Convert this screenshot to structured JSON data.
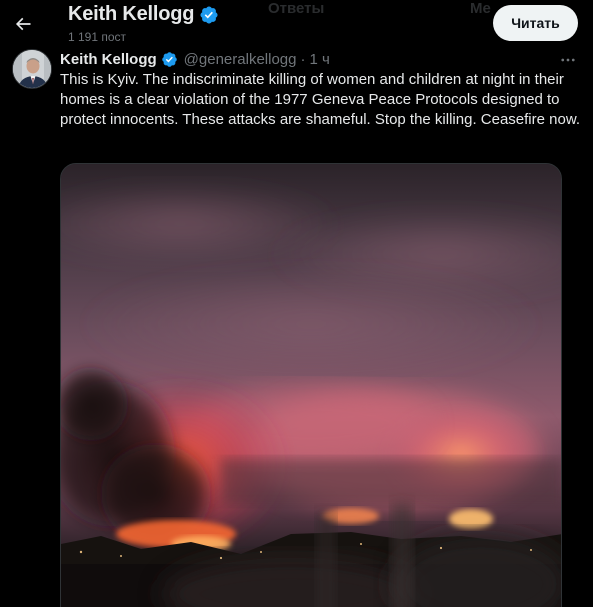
{
  "header": {
    "back_icon": "arrow-left-icon",
    "name": "Keith Kellogg",
    "verified_icon": "verified-badge-icon",
    "post_count": "1 191 пост",
    "follow_label": "Читать",
    "background_tabs": [
      "Ответы",
      "Ме"
    ]
  },
  "tweet": {
    "avatar_icon": "profile-photo",
    "author_name": "Keith Kellogg",
    "verified_icon": "verified-badge-icon",
    "handle": "@generalkellogg",
    "separator": "·",
    "time": "1 ч",
    "more_icon": "more-options-icon",
    "text": "This is Kyiv. The indiscriminate killing of women and children at night in their homes is a clear violation of the 1977 Geneva Peace Protocols designed to protect innocents. These attacks are shameful. Stop the killing. Ceasefire now.",
    "media": {
      "type": "photo",
      "subject": "night-city-fires-smoke"
    }
  },
  "colors": {
    "background": "#000000",
    "text_primary": "#e7e9ea",
    "text_secondary": "#71767b",
    "verified_blue": "#1d9bf0",
    "follow_button_bg": "#eff3f4",
    "follow_button_text": "#0f1419"
  }
}
